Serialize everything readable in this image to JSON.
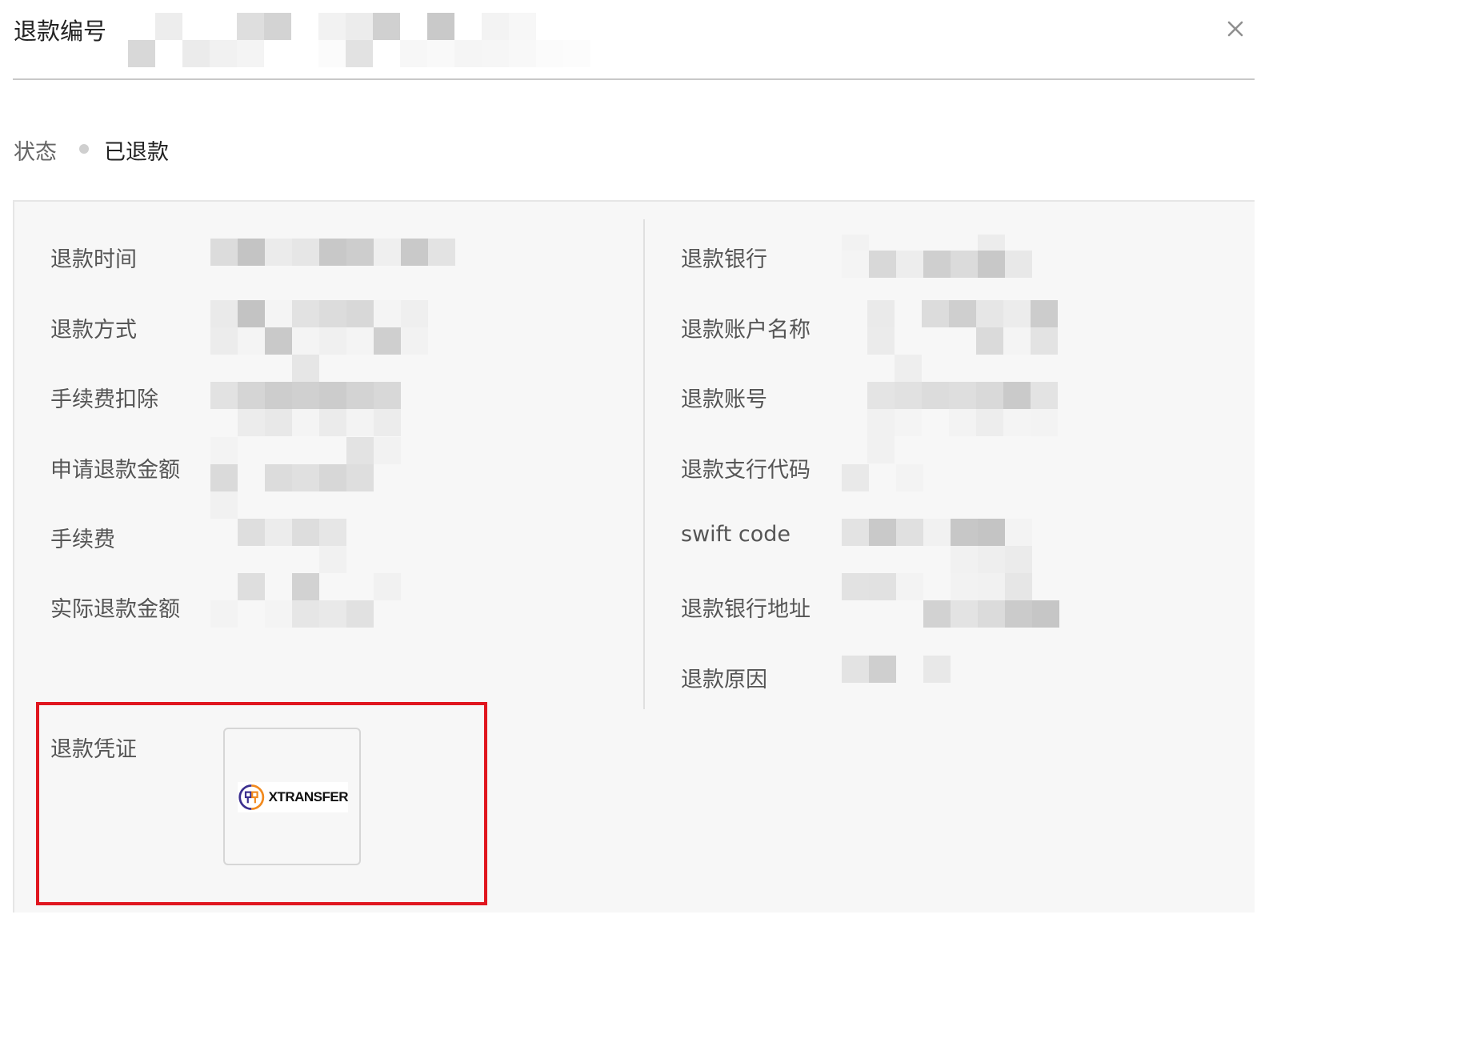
{
  "header": {
    "title": "退款编号",
    "close_icon": "close-icon"
  },
  "status": {
    "label": "状态",
    "value": "已退款",
    "dot_color": "#cfcfcf"
  },
  "left_fields": [
    {
      "label": "退款时间"
    },
    {
      "label": "退款方式"
    },
    {
      "label": "手续费扣除"
    },
    {
      "label": "申请退款金额"
    },
    {
      "label": "手续费"
    },
    {
      "label": "实际退款金额"
    }
  ],
  "right_fields": [
    {
      "label": "退款银行"
    },
    {
      "label": "退款账户名称"
    },
    {
      "label": "退款账号"
    },
    {
      "label": "退款支行代码"
    },
    {
      "label": "swift code"
    },
    {
      "label": "退款银行地址"
    },
    {
      "label": "退款原因"
    }
  ],
  "proof": {
    "label": "退款凭证",
    "thumbnail_logo_text": "XTRANSFER",
    "highlight_color": "#e0161f"
  },
  "redaction_note": "values are pixelated/redacted in the screenshot"
}
